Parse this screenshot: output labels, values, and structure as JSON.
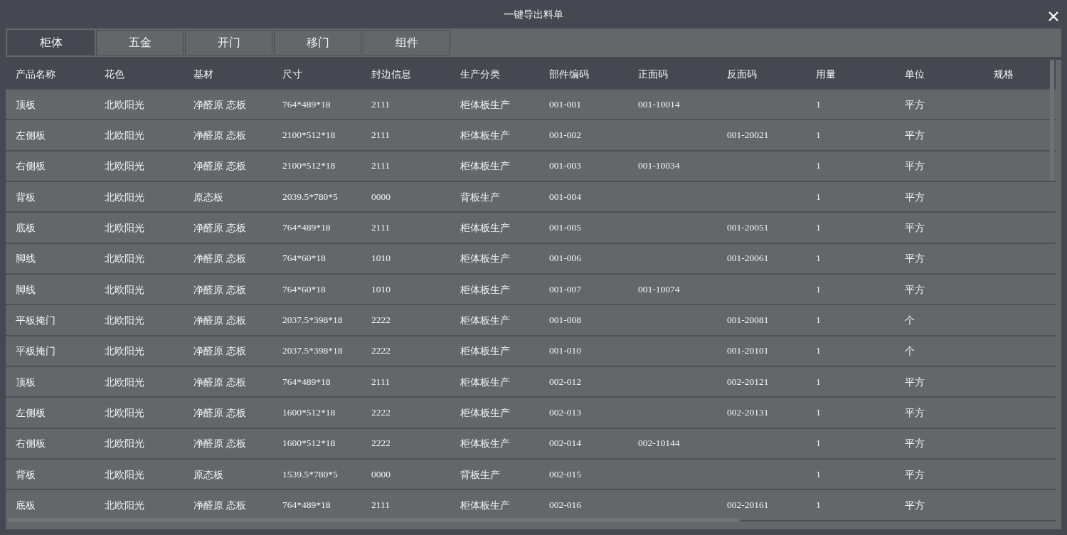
{
  "window": {
    "title": "一键导出料单"
  },
  "tabs": [
    {
      "label": "柜体",
      "selected": true
    },
    {
      "label": "五金",
      "selected": false
    },
    {
      "label": "开门",
      "selected": false
    },
    {
      "label": "移门",
      "selected": false
    },
    {
      "label": "组件",
      "selected": false
    }
  ],
  "table": {
    "columns": [
      "产品名称",
      "花色",
      "基材",
      "尺寸",
      "封边信息",
      "生产分类",
      "部件编码",
      "正面码",
      "反面码",
      "用量",
      "单位",
      "规格"
    ],
    "rows": [
      {
        "product_name": "顶板",
        "finish": "北欧阳光",
        "board": "净醛原 态板",
        "size": "764*489*18",
        "edge_banding": "2111",
        "production_type": "柜体板生产",
        "part_code": "001-001",
        "front_code": "001-10014",
        "quantity": "1",
        "unit": "平方"
      },
      {
        "product_name": "左侧板",
        "finish": "北欧阳光",
        "board": "净醛原 态板",
        "size": "2100*512*18",
        "edge_banding": "2111",
        "production_type": "柜体板生产",
        "part_code": "001-002",
        "back_code": "001-20021",
        "quantity": "1",
        "unit": "平方"
      },
      {
        "product_name": "右侧板",
        "finish": "北欧阳光",
        "board": "净醛原 态板",
        "size": "2100*512*18",
        "edge_banding": "2111",
        "production_type": "柜体板生产",
        "part_code": "001-003",
        "front_code": "001-10034",
        "quantity": "1",
        "unit": "平方"
      },
      {
        "product_name": "背板",
        "finish": "北欧阳光",
        "board": "原态板",
        "size": "2039.5*780*5",
        "edge_banding": "0000",
        "production_type": "背板生产",
        "part_code": "001-004",
        "quantity": "1",
        "unit": "平方"
      },
      {
        "product_name": "底板",
        "finish": "北欧阳光",
        "board": "净醛原 态板",
        "size": "764*489*18",
        "edge_banding": "2111",
        "production_type": "柜体板生产",
        "part_code": "001-005",
        "back_code": "001-20051",
        "quantity": "1",
        "unit": "平方"
      },
      {
        "product_name": "脚线",
        "finish": "北欧阳光",
        "board": "净醛原 态板",
        "size": "764*60*18",
        "edge_banding": "1010",
        "production_type": "柜体板生产",
        "part_code": "001-006",
        "back_code": "001-20061",
        "quantity": "1",
        "unit": "平方"
      },
      {
        "product_name": "脚线",
        "finish": "北欧阳光",
        "board": "净醛原 态板",
        "size": "764*60*18",
        "edge_banding": "1010",
        "production_type": "柜体板生产",
        "part_code": "001-007",
        "front_code": "001-10074",
        "quantity": "1",
        "unit": "平方"
      },
      {
        "product_name": "平板掩门",
        "finish": "北欧阳光",
        "board": "净醛原 态板",
        "size": "2037.5*398*18",
        "edge_banding": "2222",
        "production_type": "柜体板生产",
        "part_code": "001-008",
        "back_code": "001-20081",
        "quantity": "1",
        "unit": "个"
      },
      {
        "product_name": "平板掩门",
        "finish": "北欧阳光",
        "board": "净醛原 态板",
        "size": "2037.5*398*18",
        "edge_banding": "2222",
        "production_type": "柜体板生产",
        "part_code": "001-010",
        "back_code": "001-20101",
        "quantity": "1",
        "unit": "个"
      },
      {
        "product_name": "顶板",
        "finish": "北欧阳光",
        "board": "净醛原 态板",
        "size": "764*489*18",
        "edge_banding": "2111",
        "production_type": "柜体板生产",
        "part_code": "002-012",
        "back_code": "002-20121",
        "quantity": "1",
        "unit": "平方"
      },
      {
        "product_name": "左侧板",
        "finish": "北欧阳光",
        "board": "净醛原 态板",
        "size": "1600*512*18",
        "edge_banding": "2222",
        "production_type": "柜体板生产",
        "part_code": "002-013",
        "back_code": "002-20131",
        "quantity": "1",
        "unit": "平方"
      },
      {
        "product_name": "右侧板",
        "finish": "北欧阳光",
        "board": "净醛原 态板",
        "size": "1600*512*18",
        "edge_banding": "2222",
        "production_type": "柜体板生产",
        "part_code": "002-014",
        "front_code": "002-10144",
        "quantity": "1",
        "unit": "平方"
      },
      {
        "product_name": "背板",
        "finish": "北欧阳光",
        "board": "原态板",
        "size": "1539.5*780*5",
        "edge_banding": "0000",
        "production_type": "背板生产",
        "part_code": "002-015",
        "quantity": "1",
        "unit": "平方"
      },
      {
        "product_name": "底板",
        "finish": "北欧阳光",
        "board": "净醛原 态板",
        "size": "764*489*18",
        "edge_banding": "2111",
        "production_type": "柜体板生产",
        "part_code": "002-016",
        "back_code": "002-20161",
        "quantity": "1",
        "unit": "平方"
      }
    ]
  }
}
